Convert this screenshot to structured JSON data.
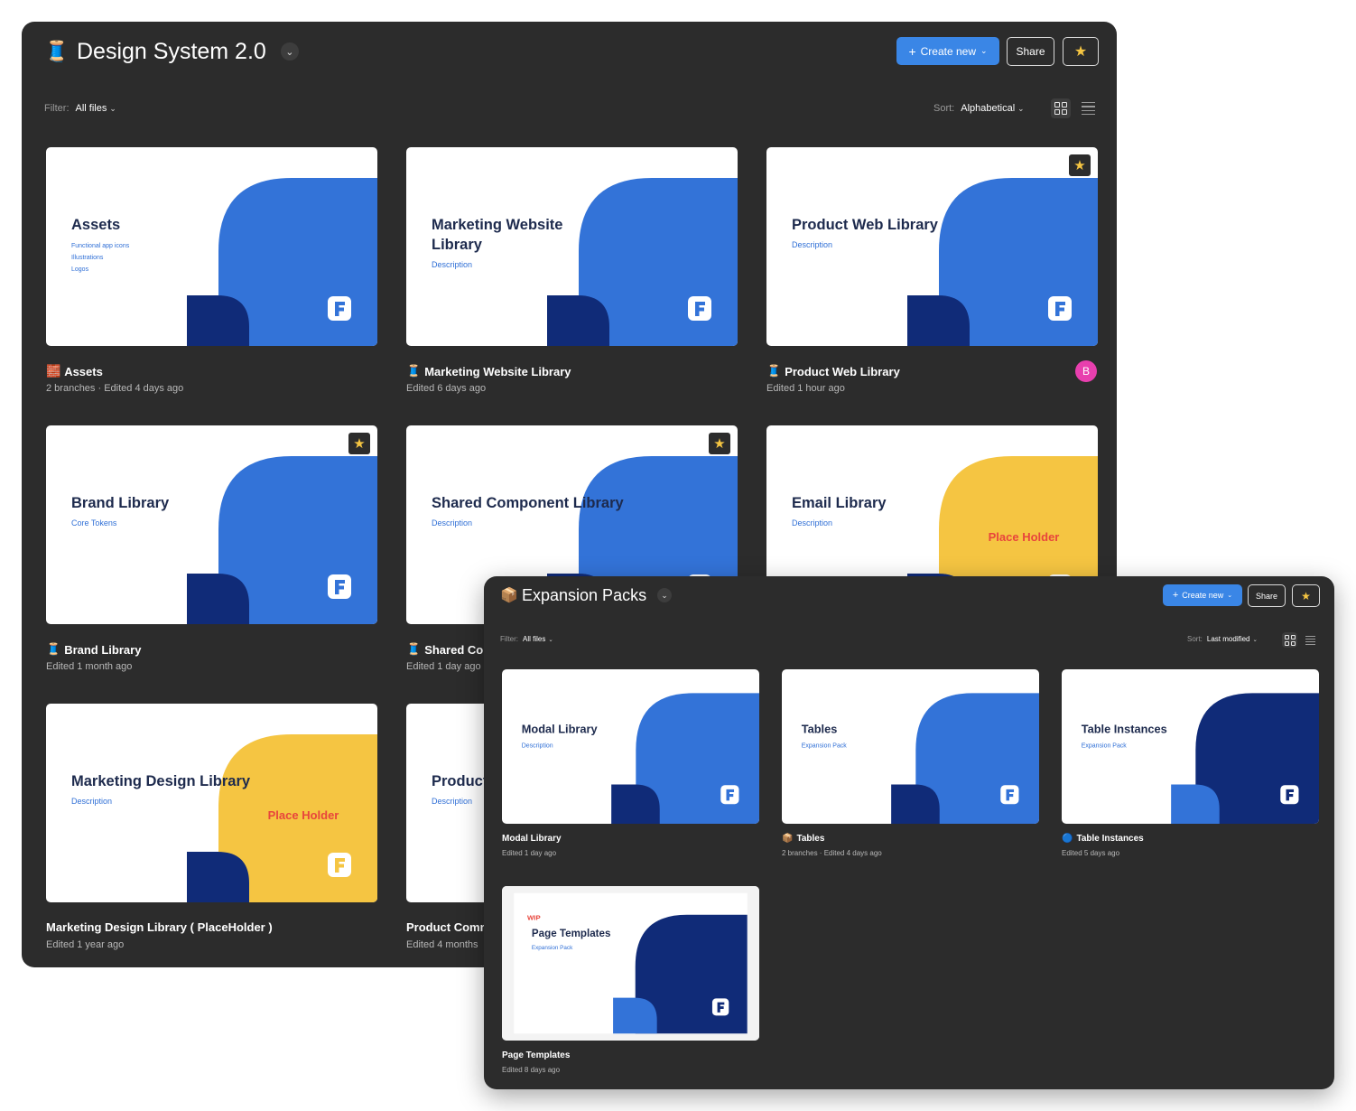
{
  "main": {
    "title": "Design System 2.0",
    "title_icon": "spool-icon",
    "buttons": {
      "create_new": "Create new",
      "share": "Share"
    },
    "filter": {
      "label": "Filter:",
      "value": "All files"
    },
    "sort": {
      "label": "Sort:",
      "value": "Alphabetical"
    },
    "files": [
      {
        "name": "Assets",
        "icon": "brick-icon",
        "emoji": "🧱",
        "meta": "2 branches · Edited 4 days ago",
        "thumb": {
          "title": [
            "Assets"
          ],
          "subtitles": [
            "Functional app icons",
            "Illustrations",
            "Logos"
          ],
          "theme": "blue"
        }
      },
      {
        "name": "Marketing Website Library",
        "icon": "spool-icon",
        "emoji": "🧵",
        "meta": "Edited 6 days ago",
        "thumb": {
          "title": [
            "Marketing Website",
            "Library"
          ],
          "subtitles": [
            "Description"
          ],
          "theme": "blue"
        }
      },
      {
        "name": "Product Web Library",
        "icon": "spool-icon",
        "emoji": "🧵",
        "meta": "Edited 1 hour ago",
        "favorite": true,
        "avatar": "B",
        "thumb": {
          "title": [
            "Product Web Library"
          ],
          "subtitles": [
            "Description"
          ],
          "theme": "blue"
        }
      },
      {
        "name": "Brand Library",
        "icon": "spool-icon",
        "emoji": "🧵",
        "meta": "Edited 1 month ago",
        "favorite": true,
        "thumb": {
          "title": [
            "Brand Library"
          ],
          "subtitles": [
            "Core Tokens"
          ],
          "theme": "blue"
        }
      },
      {
        "name": "Shared Con",
        "icon": "spool-icon",
        "emoji": "🧵",
        "meta": "Edited 1 day ago",
        "favorite": true,
        "thumb": {
          "title": [
            "Shared Component Library"
          ],
          "subtitles": [
            "Description"
          ],
          "theme": "blue"
        }
      },
      {
        "name": "Email Library",
        "meta": "",
        "thumb": {
          "title": [
            "Email Library"
          ],
          "subtitles": [
            "Description"
          ],
          "theme": "yellow",
          "placeholder": "Place Holder"
        }
      },
      {
        "name": "Marketing Design Library ( PlaceHolder )",
        "meta": "Edited 1 year ago",
        "thumb": {
          "title": [
            "Marketing Design Library"
          ],
          "subtitles": [
            "Description"
          ],
          "theme": "yellow",
          "placeholder": "Place Holder"
        }
      },
      {
        "name": "Product Comm",
        "meta": "Edited 4 months",
        "thumb": {
          "title": [
            "Product"
          ],
          "subtitles": [
            "Description"
          ],
          "theme": "blue"
        }
      }
    ]
  },
  "expansion": {
    "title": "Expansion Packs",
    "title_icon": "package-icon",
    "buttons": {
      "create_new": "Create new",
      "share": "Share"
    },
    "filter": {
      "label": "Filter:",
      "value": "All files"
    },
    "sort": {
      "label": "Sort:",
      "value": "Last modified"
    },
    "files": [
      {
        "name": "Modal Library",
        "meta": "Edited 1 day ago",
        "thumb": {
          "title": [
            "Modal Library"
          ],
          "subtitles": [
            "Description"
          ],
          "theme": "blue"
        }
      },
      {
        "name": "Tables",
        "icon": "package-icon",
        "emoji": "📦",
        "meta": "2 branches · Edited 4 days ago",
        "thumb": {
          "title": [
            "Tables"
          ],
          "subtitles": [
            "Expansion Pack"
          ],
          "theme": "blue"
        }
      },
      {
        "name": "Table Instances",
        "icon": "blue-circle-icon",
        "emoji": "🔵",
        "meta": "Edited 5 days ago",
        "thumb": {
          "title": [
            "Table Instances"
          ],
          "subtitles": [
            "Expansion Pack"
          ],
          "theme": "navy"
        }
      },
      {
        "name": "Page Templates",
        "meta": "Edited 8 days ago",
        "thumb": {
          "title": [
            "Page Templates"
          ],
          "subtitles": [
            "Expansion Pack"
          ],
          "theme": "navy",
          "wip": "WIP",
          "framed": true
        }
      }
    ]
  },
  "colors": {
    "window_bg": "#2c2c2c",
    "accent": "#3a86e6",
    "blue": "#3373d8",
    "navy": "#102b78",
    "yellow": "#f5c542",
    "placeholder_red": "#e8453c",
    "star": "#f5c542",
    "avatar": "#e83fae"
  }
}
